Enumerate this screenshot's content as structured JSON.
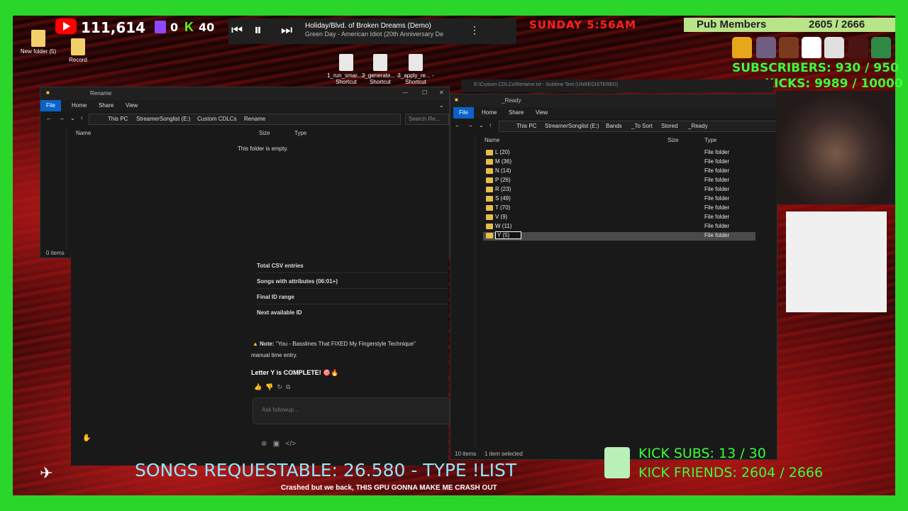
{
  "overlay": {
    "youtube_count": "111,614",
    "twitch_count": "0",
    "kick_count": "40",
    "day_time": "SUNDAY 5:56AM",
    "pub_members_label": "Pub Members",
    "pub_members_count": "2605 / 2666",
    "subscribers": "SUBSCRIBERS: 930 / 950",
    "kicks": "KICKS: 9989 / 10000",
    "ticker": "SONGS REQUESTABLE: 26.580 - TYPE !LIST",
    "kick_subs": "KICK SUBS: 13 / 30",
    "kick_friends": "KICK FRIENDS: 2604 / 2666",
    "chat_line": "Crashed but we back, THIS GPU GONNA MAKE ME CRASH OUT"
  },
  "player": {
    "song_title": "Holiday/Blvd. of Broken Dreams (Demo)",
    "song_artist": "Green Day - American Idiot (20th Anniversary De"
  },
  "desktop_icons": [
    {
      "label": "New folder (5)"
    },
    {
      "label": "Record"
    },
    {
      "label": "1_run_smar... - Shortcut"
    },
    {
      "label": "2_generate... - Shortcut"
    },
    {
      "label": "3_apply_re... - Shortcut"
    }
  ],
  "left_window": {
    "title": "Rename",
    "ribbon": [
      "File",
      "Home",
      "Share",
      "View"
    ],
    "path": [
      "This PC",
      "StreamerSonglist (E:)",
      "Custom CDLCs",
      "Rename"
    ],
    "search_placeholder": "Search Re...",
    "columns": [
      "Name",
      "Size",
      "Type"
    ],
    "empty_text": "This folder is empty.",
    "status": "0 items"
  },
  "right_window": {
    "title": "_Ready",
    "ribbon": [
      "File",
      "Home",
      "Share",
      "View"
    ],
    "path": [
      "This PC",
      "StreamerSonglist (E:)",
      "Bands",
      "_To Sort",
      "Stored",
      "_Ready"
    ],
    "columns": [
      "Name",
      "Size",
      "Type"
    ],
    "rows": [
      {
        "name": "L (20)",
        "type": "File folder"
      },
      {
        "name": "M (36)",
        "type": "File folder"
      },
      {
        "name": "N (14)",
        "type": "File folder"
      },
      {
        "name": "P (26)",
        "type": "File folder"
      },
      {
        "name": "R (23)",
        "type": "File folder"
      },
      {
        "name": "S (49)",
        "type": "File folder"
      },
      {
        "name": "T (70)",
        "type": "File folder"
      },
      {
        "name": "V (9)",
        "type": "File folder"
      },
      {
        "name": "W (11)",
        "type": "File folder"
      },
      {
        "name": "Y (5)",
        "type": "File folder"
      }
    ],
    "status_count": "10 items",
    "status_selected": "1 item selected"
  },
  "sublime": {
    "title": "E:\\Custom CDLCs\\Rename.txt - Sublime Text (UNREGISTERED)"
  },
  "chat": {
    "rows": [
      "Total CSV entries",
      "Songs with attributes (06:01+)",
      "Final ID range",
      "Next available ID"
    ],
    "note_label": "Note:",
    "note_text": "\"You - Basslines That FIXED My Fingerstyle Technique\"",
    "note_text2": "manual time entry.",
    "complete": "Letter Y is COMPLETE! 🎯🔥",
    "input_placeholder": "Ask followup..."
  }
}
